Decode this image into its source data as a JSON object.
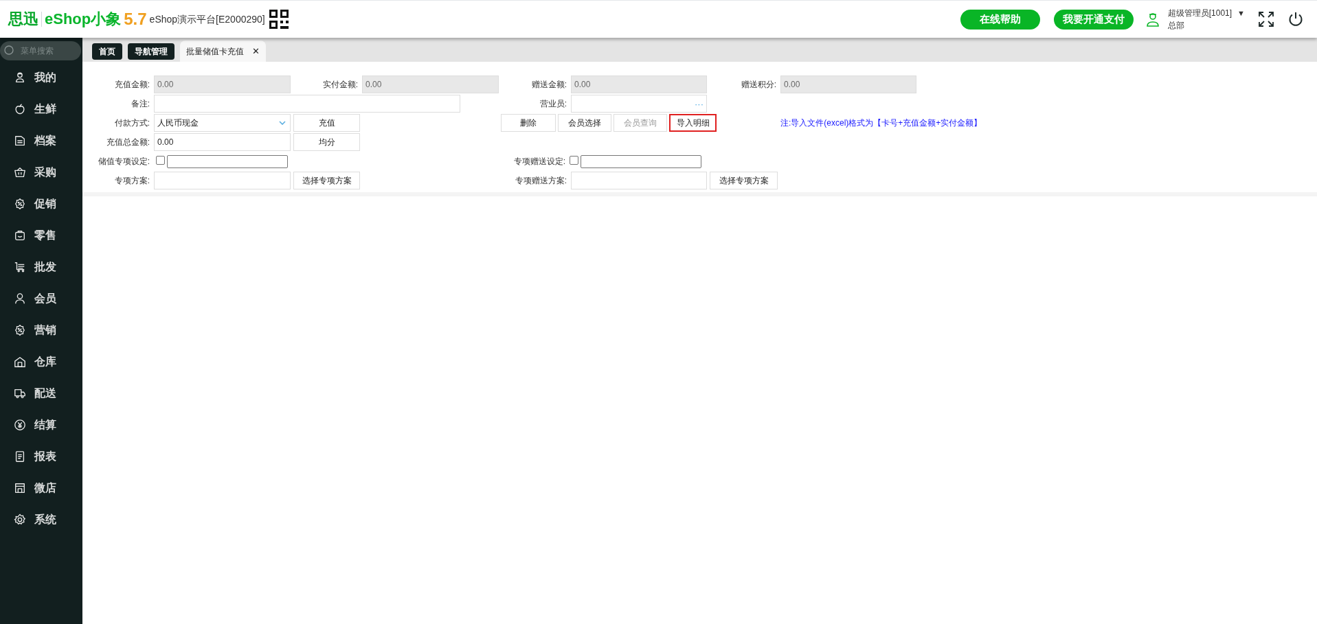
{
  "header": {
    "logo": {
      "brand": "思迅",
      "product": "eShop小象",
      "version": "5.7"
    },
    "platform": "eShop演示平台[E2000290]",
    "buttons": [
      "在线帮助",
      "我要开通支付"
    ],
    "user": {
      "name": "超级管理员[1001]",
      "dropdown": "▼",
      "org": "总部"
    }
  },
  "sidebar": {
    "search_placeholder": "菜单搜索",
    "items": [
      {
        "label": "我的",
        "selected": false
      },
      {
        "label": "生鲜",
        "selected": false
      },
      {
        "label": "档案",
        "selected": false
      },
      {
        "label": "采购",
        "selected": false
      },
      {
        "label": "促销",
        "selected": false
      },
      {
        "label": "零售",
        "selected": false
      },
      {
        "label": "批发",
        "selected": false
      },
      {
        "label": "会员",
        "selected": false
      },
      {
        "label": "营销",
        "selected": false
      },
      {
        "label": "仓库",
        "selected": false
      },
      {
        "label": "配送",
        "selected": false
      },
      {
        "label": "结算",
        "selected": false
      },
      {
        "label": "报表",
        "selected": false
      },
      {
        "label": "微店",
        "selected": false
      },
      {
        "label": "系统",
        "selected": false
      }
    ]
  },
  "tabs": [
    {
      "label": "首页",
      "selected": false
    },
    {
      "label": "导航管理",
      "selected": false
    },
    {
      "label": "批量储值卡充值",
      "selected": true,
      "close": "✕"
    }
  ],
  "form": {
    "recharge_amount": {
      "label": "充值金额:",
      "value": "0.00"
    },
    "paid_amount": {
      "label": "实付金额:",
      "value": "0.00"
    },
    "bonus_amount": {
      "label": "赠送金额:",
      "value": "0.00"
    },
    "bonus_points": {
      "label": "赠送积分:",
      "value": "0.00"
    },
    "remark": {
      "label": "备注:"
    },
    "salesperson": {
      "label": "营业员:",
      "picker": "···"
    },
    "payment_method": {
      "label": "付款方式:",
      "value": "人民币现金"
    },
    "recharge_button": "充值",
    "row_buttons": [
      {
        "label": "删除",
        "disabled": false,
        "highlighted": false
      },
      {
        "label": "会员选择",
        "disabled": false,
        "highlighted": false
      },
      {
        "label": "会员查询",
        "disabled": true,
        "highlighted": false
      },
      {
        "label": "导入明细",
        "disabled": false,
        "highlighted": true
      }
    ],
    "note": "注:导入文件(excel)格式为【卡号+充值金额+实付金额】",
    "total_amount": {
      "label": "充值总金额:",
      "value": "0.00"
    },
    "split_button": "均分",
    "special_setting": {
      "label": "储值专项设定:",
      "checked": false
    },
    "special_plan": {
      "label": "专项方案:",
      "button": "选择专项方案"
    },
    "bonus_special_setting": {
      "label": "专项赠送设定:",
      "checked": false
    },
    "bonus_special_plan": {
      "label": "专项赠送方案:",
      "button": "选择专项方案"
    }
  }
}
